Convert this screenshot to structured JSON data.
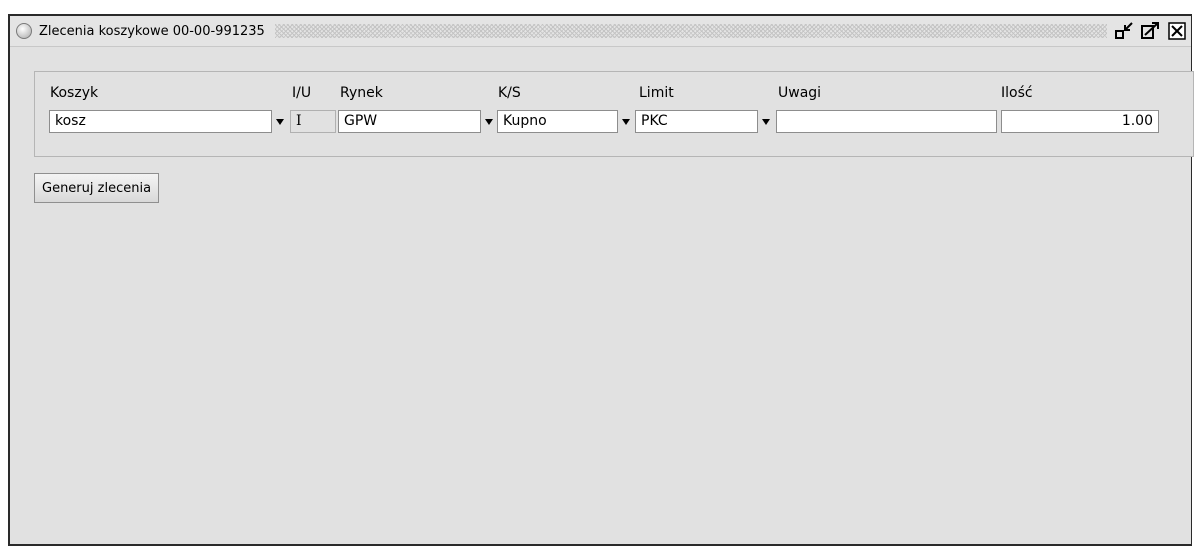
{
  "window": {
    "title": "Zlecenia koszykowe 00-00-991235"
  },
  "icons": {
    "title_bullet": "radio-circle-icon",
    "minimize": "minimize-icon",
    "maximize": "maximize-icon",
    "close": "close-icon",
    "dropdown": "dropdown-arrow-icon"
  },
  "form": {
    "labels": {
      "koszyk": "Koszyk",
      "iu": "I/U",
      "rynek": "Rynek",
      "ks": "K/S",
      "limit": "Limit",
      "uwagi": "Uwagi",
      "ilosc": "Ilość"
    },
    "values": {
      "koszyk": "kosz",
      "iu": "I",
      "rynek": "GPW",
      "ks": "Kupno",
      "limit": "PKC",
      "uwagi": "",
      "ilosc": "1.00"
    }
  },
  "actions": {
    "generate_label": "Generuj zlecenia"
  }
}
